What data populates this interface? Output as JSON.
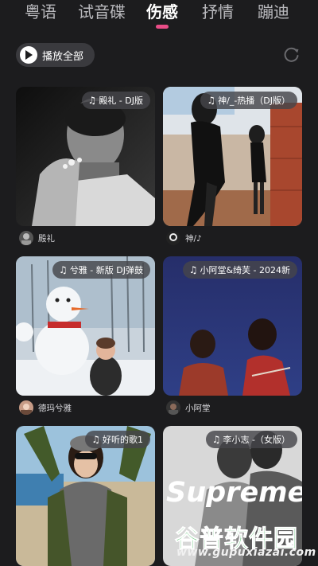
{
  "tabs": [
    {
      "label": "粤语"
    },
    {
      "label": "试音碟"
    },
    {
      "label": "伤感"
    },
    {
      "label": "抒情"
    },
    {
      "label": "蹦迪"
    }
  ],
  "active_tab": "伤感",
  "play_all": {
    "label": "播放全部"
  },
  "cards": [
    {
      "title": "殿礼 - DJ版",
      "artist": "殿礼"
    },
    {
      "title": "神/_-热播（DJ版）",
      "artist": "神/♪"
    },
    {
      "title": "兮雅 - 新版 DJ弹鼓",
      "artist": "德玛兮雅"
    },
    {
      "title": "小阿堂&绮芙 - 2024新",
      "artist": "小阿堂"
    },
    {
      "title": "好听的歌1",
      "artist": ""
    },
    {
      "title": "李小志 -（女版）",
      "artist": ""
    }
  ],
  "cover_text": {
    "supreme": "Supreme"
  },
  "watermark": {
    "title": "谷普软件园",
    "url": "www.gupuxiazai.com"
  },
  "colors": {
    "accent": "#e94d87",
    "background": "#1c1c1e",
    "watermark_green": "#2fb24a"
  }
}
